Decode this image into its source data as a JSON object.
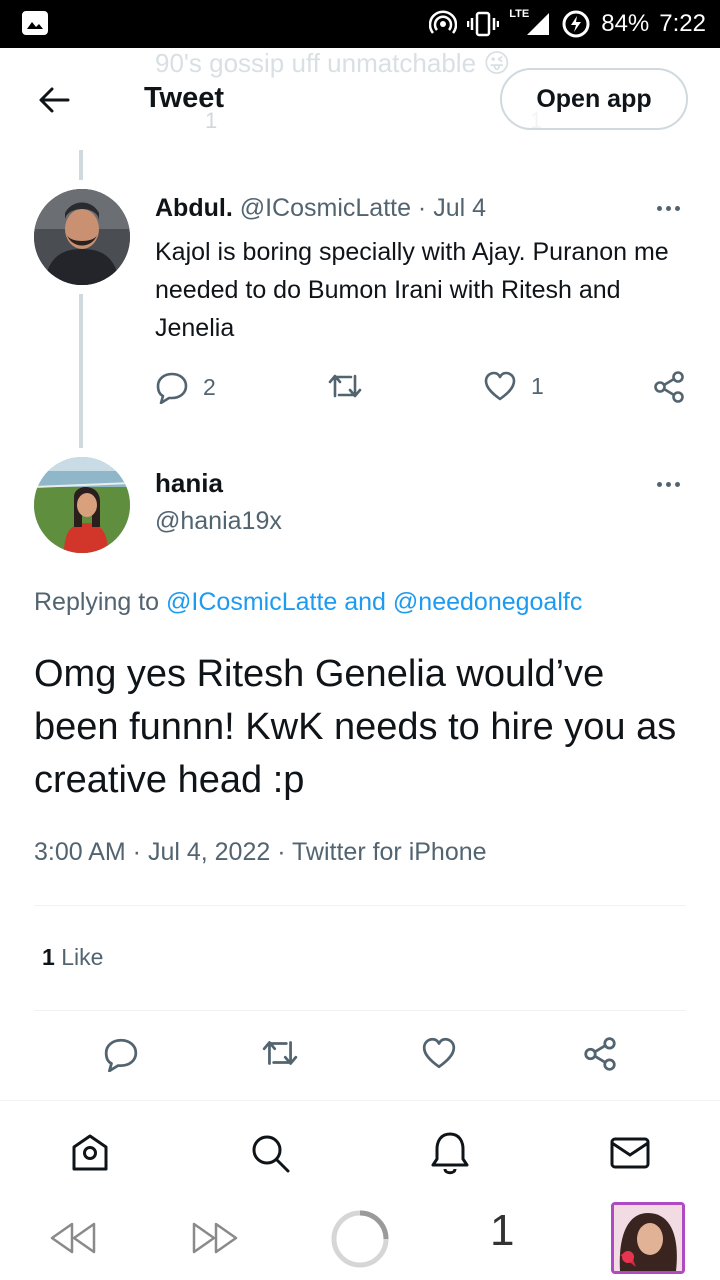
{
  "status_bar": {
    "network": "LTE",
    "battery": "84%",
    "time": "7:22"
  },
  "header": {
    "ghost_text": "90's gossip uff unmatchable 😜",
    "ghost_reply_count": "1",
    "ghost_like_count": "1",
    "title": "Tweet",
    "open_app_label": "Open app"
  },
  "parent_tweet": {
    "name": "Abdul.",
    "handle": "@ICosmicLatte",
    "date": "Jul 4",
    "meta": "@ICosmicLatte · Jul 4",
    "text": "Kajol is boring specially with Ajay. Puranon me needed to do Bumon Irani with Ritesh and Jenelia",
    "reply_count": "2",
    "like_count": "1"
  },
  "main_tweet": {
    "name": "hania",
    "handle": "@hania19x",
    "replying_prefix": "Replying to",
    "replying_user1": "@ICosmicLatte",
    "replying_and": "and",
    "replying_user2": "@needonegoalfc",
    "text": "Omg yes Ritesh Genelia would’ve been funnn! KwK needs to hire you as creative head :p",
    "timestamp": "3:00 AM · Jul 4, 2022 · Twitter for iPhone",
    "like_count": "1",
    "like_label": "Like"
  },
  "android_nav": {
    "tab_count": "1"
  },
  "colors": {
    "accent": "#1d9bf0",
    "text_primary": "#0f1419",
    "text_secondary": "#536471",
    "border": "#cfd9de"
  },
  "icons": [
    "back-arrow-icon",
    "more-icon",
    "reply-icon",
    "retweet-icon",
    "like-icon",
    "share-icon",
    "home-icon",
    "search-icon",
    "notifications-icon",
    "messages-icon"
  ]
}
